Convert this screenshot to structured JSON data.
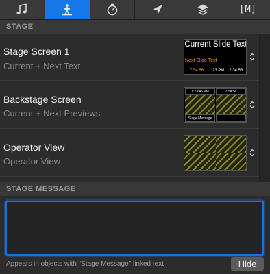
{
  "tabs": [
    {
      "icon": "music-note-icon"
    },
    {
      "icon": "stage-icon"
    },
    {
      "icon": "timer-icon"
    },
    {
      "icon": "location-arrow-icon"
    },
    {
      "icon": "layers-icon"
    },
    {
      "icon": "macro-icon",
      "label": "[M]"
    }
  ],
  "active_tab_index": 1,
  "stage": {
    "header": "STAGE",
    "screens": [
      {
        "title": "Stage Screen 1",
        "layout": "Current + Next Text",
        "preview": {
          "current_slide": "Current Slide Text",
          "next_slide": "Next Slide Text",
          "countdown": "7:54:56",
          "clock": "1:23 PM",
          "elapsed": "12:34:56"
        }
      },
      {
        "title": "Backstage Screen",
        "layout": "Current + Next Previews",
        "preview": {
          "clock": "1:23:45 PM",
          "countdown": "7:54:56",
          "message": "Stage Message"
        }
      },
      {
        "title": "Operator View",
        "layout": "Operator View"
      }
    ]
  },
  "message": {
    "header": "STAGE MESSAGE",
    "value": "",
    "hint": "Appears in objects with \"Stage Message\" linked text",
    "hide_label": "Hide"
  },
  "colors": {
    "accent": "#1677e8",
    "next_slide_text": "#e8a21c",
    "countdown_text": "#e8a21c"
  }
}
